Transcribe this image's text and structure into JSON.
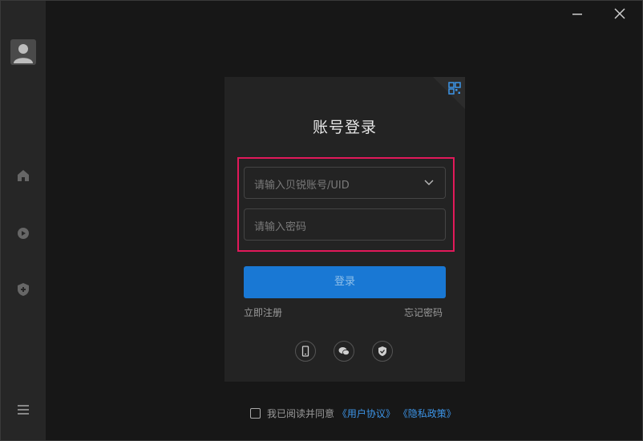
{
  "window": {
    "minimize_icon": "minimize-icon",
    "close_icon": "close-icon"
  },
  "sidebar": {
    "avatar_icon": "user-avatar-icon",
    "items": [
      {
        "icon": "home-icon"
      },
      {
        "icon": "circle-play-icon"
      },
      {
        "icon": "shield-plus-icon"
      }
    ],
    "menu_icon": "hamburger-menu-icon"
  },
  "login": {
    "title": "账号登录",
    "qr_icon": "qr-code-icon",
    "account_placeholder": "请输入贝锐账号/UID",
    "password_placeholder": "请输入密码",
    "login_label": "登录",
    "register_label": "立即注册",
    "forgot_label": "忘记密码",
    "alt_methods": [
      {
        "icon": "phone-icon"
      },
      {
        "icon": "wechat-icon"
      },
      {
        "icon": "shield-check-icon"
      }
    ]
  },
  "agreement": {
    "text": "我已阅读并同意",
    "user_agreement": "《用户协议》",
    "privacy_policy": "《隐私政策》"
  },
  "colors": {
    "accent": "#1978d4",
    "highlight": "#e1195a",
    "link": "#3d95e8"
  }
}
